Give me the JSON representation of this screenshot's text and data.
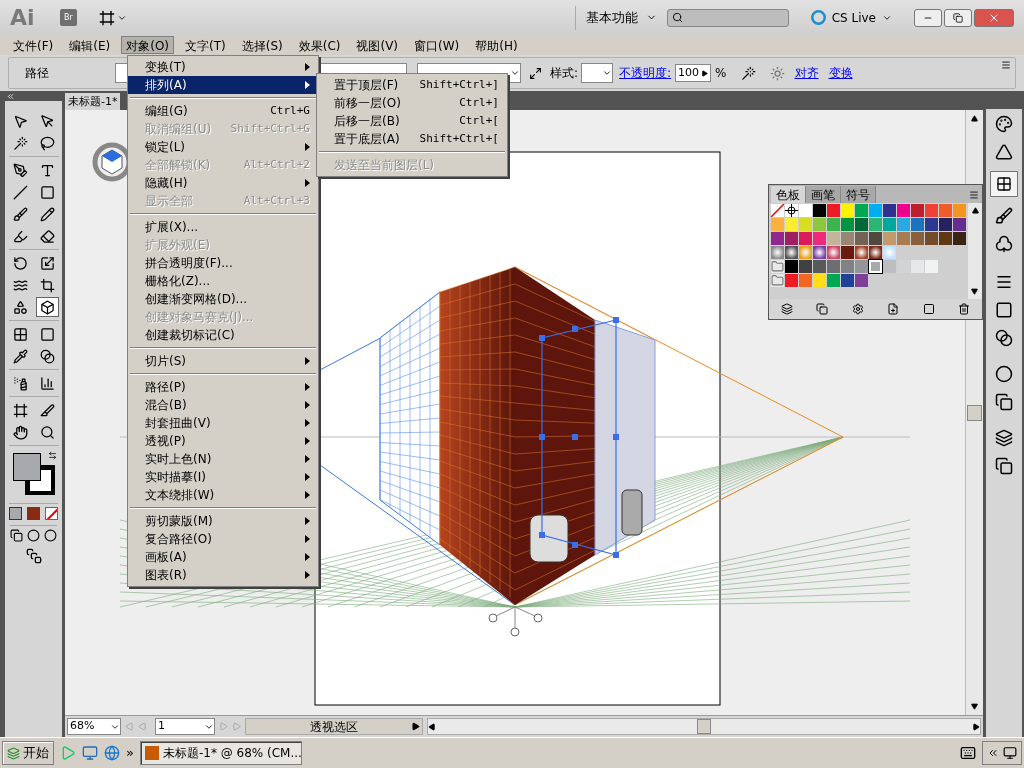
{
  "title_bar": {
    "logo": "Ai",
    "bridge_button": "Br",
    "workspace": "基本功能",
    "cs_live": "CS Live"
  },
  "menubar": [
    {
      "label": "文件(F)",
      "selected": false
    },
    {
      "label": "编辑(E)",
      "selected": false
    },
    {
      "label": "对象(O)",
      "selected": true
    },
    {
      "label": "文字(T)",
      "selected": false
    },
    {
      "label": "选择(S)",
      "selected": false
    },
    {
      "label": "效果(C)",
      "selected": false
    },
    {
      "label": "视图(V)",
      "selected": false
    },
    {
      "label": "窗口(W)",
      "selected": false
    },
    {
      "label": "帮助(H)",
      "selected": false
    }
  ],
  "control_bar": {
    "selection_label": "路径",
    "style_label": "样式:",
    "opacity_label": "不透明度:",
    "opacity_value": "100",
    "opacity_unit": "%",
    "align_link": "对齐",
    "transform_link": "变换"
  },
  "document_tab": {
    "title": "未标题-1*"
  },
  "tool_groups": [
    {
      "tools": [
        {
          "selected": false
        },
        {
          "selected": false
        },
        {
          "selected": false
        },
        {
          "selected": false
        }
      ]
    },
    {
      "tools": [
        {
          "selected": false
        },
        {
          "selected": false
        },
        {
          "selected": false
        },
        {
          "selected": false
        },
        {
          "selected": false
        },
        {
          "selected": false
        },
        {
          "selected": false
        },
        {
          "selected": false
        }
      ]
    },
    {
      "tools": [
        {
          "selected": false
        },
        {
          "selected": false
        },
        {
          "selected": false
        },
        {
          "selected": false
        },
        {
          "selected": false
        },
        {
          "selected": true
        }
      ]
    },
    {
      "tools": [
        {
          "selected": false
        },
        {
          "selected": false
        },
        {
          "selected": false
        },
        {
          "selected": false
        }
      ]
    },
    {
      "tools": [
        {
          "selected": false
        },
        {
          "selected": false
        }
      ]
    },
    {
      "tools": [
        {
          "selected": false
        },
        {
          "selected": false
        },
        {
          "selected": false
        },
        {
          "selected": false
        }
      ]
    }
  ],
  "fill_stroke": {
    "fill": {
      "color": "#a7a9ac"
    },
    "stroke": {
      "color": "#000000"
    }
  },
  "object_menu": {
    "items": [
      {
        "kind": "item",
        "label": "变换(T)",
        "disabled": false,
        "submenu": true,
        "selected": false
      },
      {
        "kind": "item",
        "label": "排列(A)",
        "disabled": false,
        "submenu": true,
        "selected": true
      },
      {
        "kind": "separator"
      },
      {
        "kind": "item",
        "label": "编组(G)",
        "shortcut": "Ctrl+G",
        "disabled": false,
        "submenu": false,
        "selected": false
      },
      {
        "kind": "item",
        "label": "取消编组(U)",
        "shortcut": "Shift+Ctrl+G",
        "disabled": true,
        "submenu": false,
        "selected": false
      },
      {
        "kind": "item",
        "label": "锁定(L)",
        "disabled": false,
        "submenu": true,
        "selected": false
      },
      {
        "kind": "item",
        "label": "全部解锁(K)",
        "shortcut": "Alt+Ctrl+2",
        "disabled": true,
        "submenu": false,
        "selected": false
      },
      {
        "kind": "item",
        "label": "隐藏(H)",
        "disabled": false,
        "submenu": true,
        "selected": false
      },
      {
        "kind": "item",
        "label": "显示全部",
        "shortcut": "Alt+Ctrl+3",
        "disabled": true,
        "submenu": false,
        "selected": false
      },
      {
        "kind": "separator"
      },
      {
        "kind": "item",
        "label": "扩展(X)...",
        "disabled": false,
        "submenu": false,
        "selected": false
      },
      {
        "kind": "item",
        "label": "扩展外观(E)",
        "disabled": true,
        "submenu": false,
        "selected": false
      },
      {
        "kind": "item",
        "label": "拼合透明度(F)...",
        "disabled": false,
        "submenu": false,
        "selected": false
      },
      {
        "kind": "item",
        "label": "栅格化(Z)...",
        "disabled": false,
        "submenu": false,
        "selected": false
      },
      {
        "kind": "item",
        "label": "创建渐变网格(D)...",
        "disabled": false,
        "submenu": false,
        "selected": false
      },
      {
        "kind": "item",
        "label": "创建对象马赛克(J)...",
        "disabled": true,
        "submenu": false,
        "selected": false
      },
      {
        "kind": "item",
        "label": "创建裁切标记(C)",
        "disabled": false,
        "submenu": false,
        "selected": false
      },
      {
        "kind": "separator"
      },
      {
        "kind": "item",
        "label": "切片(S)",
        "disabled": false,
        "submenu": true,
        "selected": false
      },
      {
        "kind": "separator"
      },
      {
        "kind": "item",
        "label": "路径(P)",
        "disabled": false,
        "submenu": true,
        "selected": false
      },
      {
        "kind": "item",
        "label": "混合(B)",
        "disabled": false,
        "submenu": true,
        "selected": false
      },
      {
        "kind": "item",
        "label": "封套扭曲(V)",
        "disabled": false,
        "submenu": true,
        "selected": false
      },
      {
        "kind": "item",
        "label": "透视(P)",
        "disabled": false,
        "submenu": true,
        "selected": false
      },
      {
        "kind": "item",
        "label": "实时上色(N)",
        "disabled": false,
        "submenu": true,
        "selected": false
      },
      {
        "kind": "item",
        "label": "实时描摹(I)",
        "disabled": false,
        "submenu": true,
        "selected": false
      },
      {
        "kind": "item",
        "label": "文本绕排(W)",
        "disabled": false,
        "submenu": true,
        "selected": false
      },
      {
        "kind": "separator"
      },
      {
        "kind": "item",
        "label": "剪切蒙版(M)",
        "disabled": false,
        "submenu": true,
        "selected": false
      },
      {
        "kind": "item",
        "label": "复合路径(O)",
        "disabled": false,
        "submenu": true,
        "selected": false
      },
      {
        "kind": "item",
        "label": "画板(A)",
        "disabled": false,
        "submenu": true,
        "selected": false
      },
      {
        "kind": "item",
        "label": "图表(R)",
        "disabled": false,
        "submenu": true,
        "selected": false
      }
    ]
  },
  "arrange_submenu": {
    "items": [
      {
        "kind": "item",
        "label": "置于顶层(F)",
        "shortcut": "Shift+Ctrl+]",
        "disabled": false,
        "submenu": false,
        "selected": false
      },
      {
        "kind": "item",
        "label": "前移一层(O)",
        "shortcut": "Ctrl+]",
        "disabled": false,
        "submenu": false,
        "selected": false
      },
      {
        "kind": "item",
        "label": "后移一层(B)",
        "shortcut": "Ctrl+[",
        "disabled": false,
        "submenu": false,
        "selected": false
      },
      {
        "kind": "item",
        "label": "置于底层(A)",
        "shortcut": "Shift+Ctrl+[",
        "disabled": false,
        "submenu": false,
        "selected": false
      },
      {
        "kind": "separator"
      },
      {
        "kind": "item",
        "label": "发送至当前图层(L)",
        "disabled": true,
        "submenu": false,
        "selected": false
      }
    ]
  },
  "swatches_panel": {
    "tabs": [
      {
        "label": "色板",
        "selected": true
      },
      {
        "label": "画笔",
        "selected": false
      },
      {
        "label": "符号",
        "selected": false
      }
    ],
    "rows": [
      {
        "swatches": [
          {
            "kind": "none",
            "selected": false
          },
          {
            "kind": "registration",
            "selected": false
          },
          {
            "kind": "color",
            "color": "#ffffff",
            "selected": false
          },
          {
            "kind": "color",
            "color": "#000000",
            "selected": false
          },
          {
            "kind": "color",
            "color": "#ed1c24",
            "selected": false
          },
          {
            "kind": "color",
            "color": "#fff200",
            "selected": false
          },
          {
            "kind": "color",
            "color": "#00a651",
            "selected": false
          },
          {
            "kind": "color",
            "color": "#00aeef",
            "selected": false
          },
          {
            "kind": "color",
            "color": "#2e3192",
            "selected": false
          },
          {
            "kind": "color",
            "color": "#ec008c",
            "selected": false
          },
          {
            "kind": "color",
            "color": "#be1e2d",
            "selected": false
          },
          {
            "kind": "color",
            "color": "#ef4136",
            "selected": false
          },
          {
            "kind": "color",
            "color": "#f15a29",
            "selected": false
          },
          {
            "kind": "color",
            "color": "#f7941d",
            "selected": false
          }
        ]
      },
      {
        "swatches": [
          {
            "kind": "color",
            "color": "#fbb040",
            "selected": false
          },
          {
            "kind": "color",
            "color": "#f9ed32",
            "selected": false
          },
          {
            "kind": "color",
            "color": "#d7df23",
            "selected": false
          },
          {
            "kind": "color",
            "color": "#8dc63f",
            "selected": false
          },
          {
            "kind": "color",
            "color": "#39b54a",
            "selected": false
          },
          {
            "kind": "color",
            "color": "#009444",
            "selected": false
          },
          {
            "kind": "color",
            "color": "#006838",
            "selected": false
          },
          {
            "kind": "color",
            "color": "#2bb673",
            "selected": false
          },
          {
            "kind": "color",
            "color": "#00a79d",
            "selected": false
          },
          {
            "kind": "color",
            "color": "#27aae1",
            "selected": false
          },
          {
            "kind": "color",
            "color": "#1c75bc",
            "selected": false
          },
          {
            "kind": "color",
            "color": "#2b3990",
            "selected": false
          },
          {
            "kind": "color",
            "color": "#262262",
            "selected": false
          },
          {
            "kind": "color",
            "color": "#662d91",
            "selected": false
          }
        ]
      },
      {
        "swatches": [
          {
            "kind": "color",
            "color": "#92278f",
            "selected": false
          },
          {
            "kind": "color",
            "color": "#9e1f63",
            "selected": false
          },
          {
            "kind": "color",
            "color": "#da1c5c",
            "selected": false
          },
          {
            "kind": "color",
            "color": "#ee2a7b",
            "selected": false
          },
          {
            "kind": "color",
            "color": "#c2b59b",
            "selected": false
          },
          {
            "kind": "color",
            "color": "#998675",
            "selected": false
          },
          {
            "kind": "color",
            "color": "#736357",
            "selected": false
          },
          {
            "kind": "color",
            "color": "#534741",
            "selected": false
          },
          {
            "kind": "color",
            "color": "#c49a6c",
            "selected": false
          },
          {
            "kind": "color",
            "color": "#a97c50",
            "selected": false
          },
          {
            "kind": "color",
            "color": "#8b5e3c",
            "selected": false
          },
          {
            "kind": "color",
            "color": "#754c29",
            "selected": false
          },
          {
            "kind": "color",
            "color": "#603913",
            "selected": false
          },
          {
            "kind": "color",
            "color": "#3c2415",
            "selected": false
          }
        ]
      },
      {
        "swatches": [
          {
            "kind": "pattern",
            "color": "#8a8a8a",
            "selected": false
          },
          {
            "kind": "pattern",
            "color": "#555555",
            "selected": false
          },
          {
            "kind": "pattern",
            "color": "#e8a020",
            "selected": false
          },
          {
            "kind": "pattern",
            "color": "#7b3fa0",
            "selected": false
          },
          {
            "kind": "pattern",
            "color": "#cc4466",
            "selected": false
          },
          {
            "kind": "color",
            "color": "#6b1a10",
            "selected": false
          },
          {
            "kind": "pattern",
            "color": "#a0422a",
            "selected": false
          },
          {
            "kind": "pattern",
            "color": "#7a2a18",
            "selected": false
          },
          {
            "kind": "pattern",
            "color": "#bfe0ff",
            "selected": false
          }
        ]
      },
      {
        "swatches": [
          {
            "kind": "group",
            "selected": false
          },
          {
            "kind": "color",
            "color": "#000000",
            "selected": false
          },
          {
            "kind": "color",
            "color": "#414042",
            "selected": false
          },
          {
            "kind": "color",
            "color": "#58595b",
            "selected": false
          },
          {
            "kind": "color",
            "color": "#6d6e71",
            "selected": false
          },
          {
            "kind": "color",
            "color": "#808285",
            "selected": false
          },
          {
            "kind": "color",
            "color": "#939598",
            "selected": false
          },
          {
            "kind": "color",
            "color": "#a7a9ac",
            "selected": true
          },
          {
            "kind": "color",
            "color": "#bcbec0",
            "selected": false
          },
          {
            "kind": "color",
            "color": "#d1d3d4",
            "selected": false
          },
          {
            "kind": "color",
            "color": "#e6e7e8",
            "selected": false
          },
          {
            "kind": "color",
            "color": "#f1f2f2",
            "selected": false
          }
        ]
      },
      {
        "swatches": [
          {
            "kind": "group",
            "selected": false
          },
          {
            "kind": "color",
            "color": "#ed1c24",
            "selected": false
          },
          {
            "kind": "color",
            "color": "#f26522",
            "selected": false
          },
          {
            "kind": "color",
            "color": "#ffde17",
            "selected": false
          },
          {
            "kind": "color",
            "color": "#00a651",
            "selected": false
          },
          {
            "kind": "color",
            "color": "#21409a",
            "selected": false
          },
          {
            "kind": "color",
            "color": "#7f3f98",
            "selected": false
          }
        ]
      }
    ]
  },
  "status_bar": {
    "zoom": "68%",
    "page": "1",
    "status": "透视选区"
  },
  "taskbar": {
    "start": "开始",
    "more": "»",
    "task": "未标题-1* @ 68% (CM..."
  }
}
